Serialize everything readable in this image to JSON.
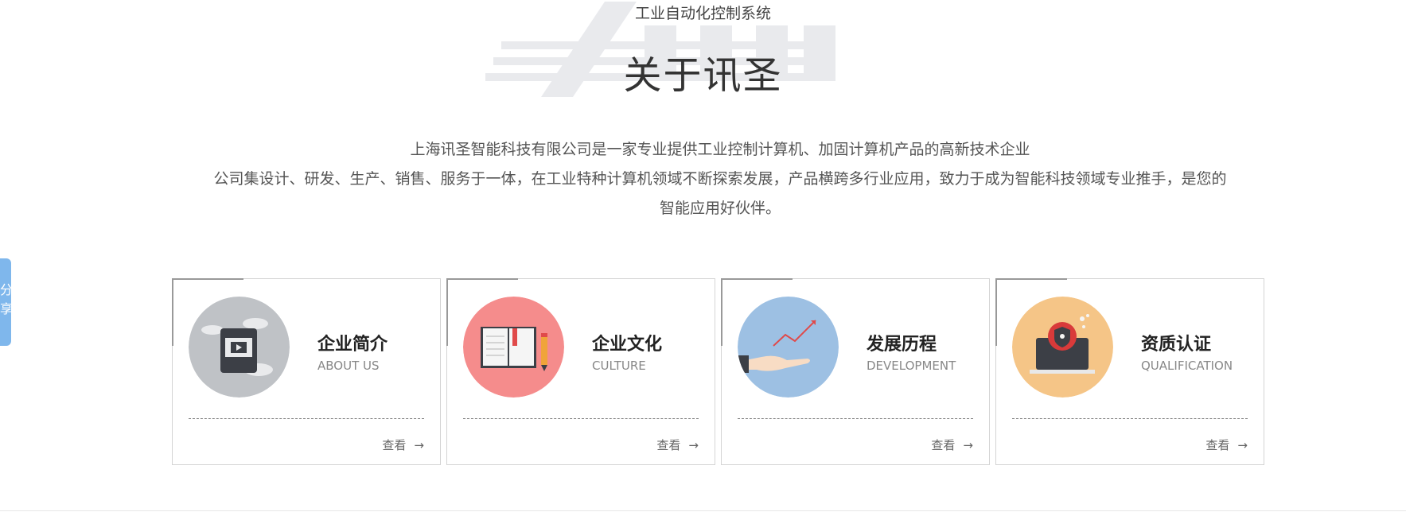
{
  "header": {
    "subtitle": "工业自动化控制系统",
    "title": "关于讯圣"
  },
  "intro": {
    "line1": "上海讯圣智能科技有限公司是一家专业提供工业控制计算机、加固计算机产品的高新技术企业",
    "line2": "公司集设计、研发、生产、销售、服务于一体，在工业特种计算机领域不断探索发展，产品横跨多行业应用，致力于成为智能科技领域专业推手，是您的智能应用好伙伴。"
  },
  "share": {
    "label": "分享"
  },
  "cards": [
    {
      "title": "企业简介",
      "subtitle": "ABOUT US",
      "link": "查看",
      "icon": "video-tablet-icon",
      "color": "#bfc2c6"
    },
    {
      "title": "企业文化",
      "subtitle": "CULTURE",
      "link": "查看",
      "icon": "open-book-icon",
      "color": "#f58c8c"
    },
    {
      "title": "发展历程",
      "subtitle": "DEVELOPMENT",
      "link": "查看",
      "icon": "growth-chart-hand-icon",
      "color": "#9dc0e3"
    },
    {
      "title": "资质认证",
      "subtitle": "QUALIFICATION",
      "link": "查看",
      "icon": "security-laptop-icon",
      "color": "#f5c587"
    }
  ]
}
